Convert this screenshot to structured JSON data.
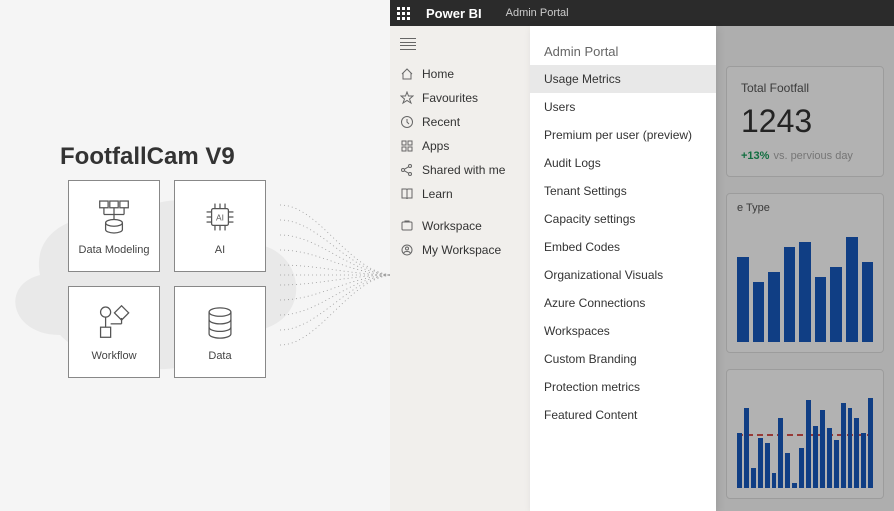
{
  "product_title": "FootfallCam V9",
  "tiles": [
    {
      "label": "Data Modeling"
    },
    {
      "label": "AI"
    },
    {
      "label": "Workflow"
    },
    {
      "label": "Data"
    }
  ],
  "topbar": {
    "brand": "Power BI",
    "breadcrumb": "Admin Portal"
  },
  "sidebar": {
    "items": [
      {
        "label": "Home",
        "icon": "home-icon"
      },
      {
        "label": "Favourites",
        "icon": "star-icon"
      },
      {
        "label": "Recent",
        "icon": "clock-icon"
      },
      {
        "label": "Apps",
        "icon": "apps-icon"
      },
      {
        "label": "Shared with me",
        "icon": "share-icon"
      },
      {
        "label": "Learn",
        "icon": "book-icon"
      }
    ],
    "items2": [
      {
        "label": "Workspace",
        "icon": "workspace-icon"
      },
      {
        "label": "My Workspace",
        "icon": "my-workspace-icon"
      }
    ]
  },
  "admin": {
    "title": "Admin Portal",
    "items": [
      "Usage Metrics",
      "Users",
      "Premium per user (preview)",
      "Audit Logs",
      "Tenant Settings",
      "Capacity settings",
      "Embed Codes",
      "Organizational Visuals",
      "Azure Connections",
      "Workspaces",
      "Custom Branding",
      "Protection metrics",
      "Featured Content"
    ],
    "active_index": 0
  },
  "dashboard": {
    "card1_title": "Total Footfall",
    "card1_value": "1243",
    "card1_pct": "+13%",
    "card1_vs": "vs. pervious day",
    "chart1_label": "e Type"
  },
  "chart_data": [
    {
      "type": "bar",
      "title": "e Type",
      "values": [
        85,
        60,
        70,
        95,
        100,
        65,
        75,
        105,
        80
      ],
      "ylim": [
        0,
        110
      ]
    },
    {
      "type": "bar",
      "values": [
        55,
        80,
        20,
        50,
        45,
        15,
        70,
        35,
        5,
        40,
        88,
        62,
        78,
        60,
        48,
        85,
        80,
        70,
        55,
        90
      ],
      "threshold": 45,
      "ylim": [
        0,
        90
      ]
    }
  ]
}
